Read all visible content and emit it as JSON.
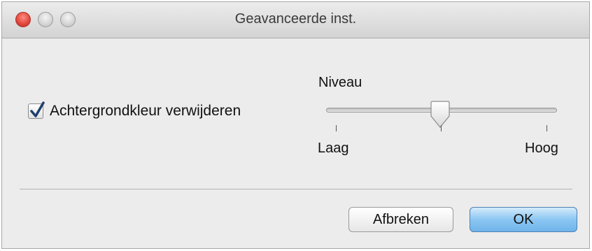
{
  "window": {
    "title": "Geavanceerde inst."
  },
  "options": {
    "remove_background_label": "Achtergrondkleur verwijderen",
    "remove_background_checked": true
  },
  "level": {
    "label": "Niveau",
    "min_label": "Laag",
    "max_label": "Hoog",
    "value_fraction": 0.5
  },
  "buttons": {
    "cancel_label": "Afbreken",
    "ok_label": "OK"
  },
  "colors": {
    "close_button": "#e0443a",
    "ok_button": "#8cc6f2"
  }
}
